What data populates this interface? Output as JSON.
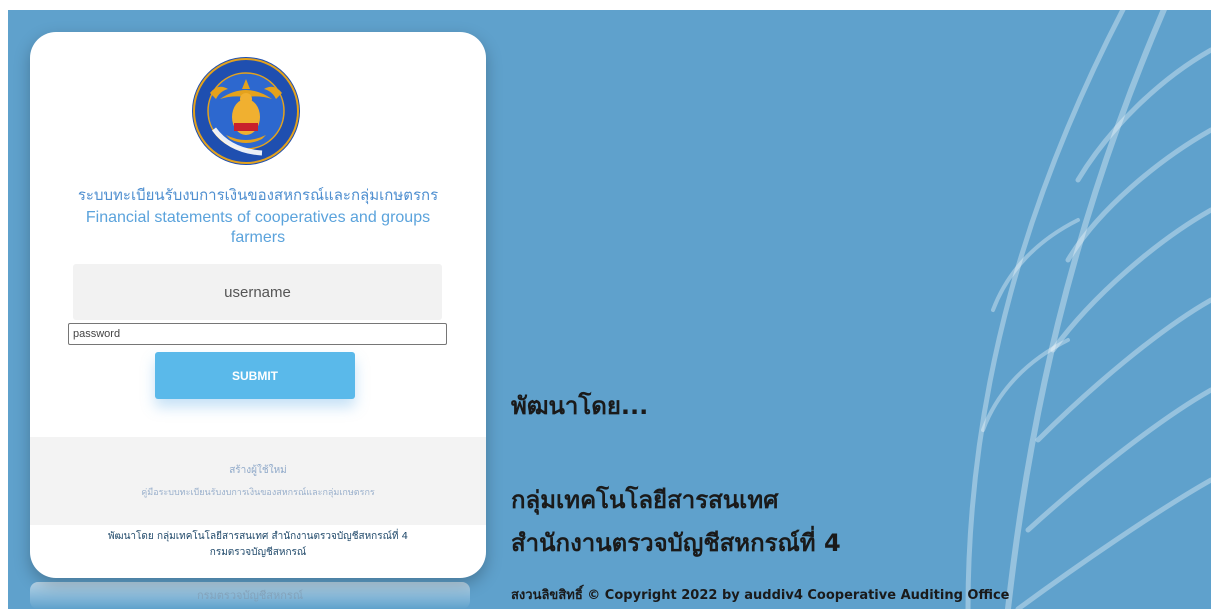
{
  "login": {
    "title_th": "ระบบทะเบียนรับงบการเงินของสหกรณ์และกลุ่มเกษตรกร",
    "title_en": "Financial statements of cooperatives and groups farmers",
    "username_placeholder": "username",
    "password_placeholder": "password",
    "submit_label": "SUBMIT",
    "link_register": "สร้างผู้ใช้ใหม่",
    "link_manual": "คู่มือระบบทะเบียนรับงบการเงินของสหกรณ์และกลุ่มเกษตรกร",
    "credit_line1": "พัฒนาโดย กลุ่มเทคโนโลยีสารสนเทศ สำนักงานตรวจบัญชีสหกรณ์ที่ 4",
    "credit_line2": "กรมตรวจบัญชีสหกรณ์"
  },
  "logo": {
    "text": "กรมตรวจบัญชีสหกรณ์",
    "colors": {
      "ring": "#1f4fb0",
      "gold": "#e4a21c",
      "red": "#c8202c"
    }
  },
  "right_panel": {
    "developed_by": "พัฒนาโดย...",
    "group_name": "กลุ่มเทคโนโลยีสารสนเทศ",
    "office_name": "สำนักงานตรวจบัญชีสหกรณ์ที่ 4",
    "copyright": "สงวนลิขสิทธิ์ © Copyright 2022 by auddiv4 Cooperative Auditing Office"
  },
  "colors": {
    "background": "#5fa1cc",
    "submit_button": "#5ab9ea",
    "title_blue": "#4f8fd0"
  }
}
